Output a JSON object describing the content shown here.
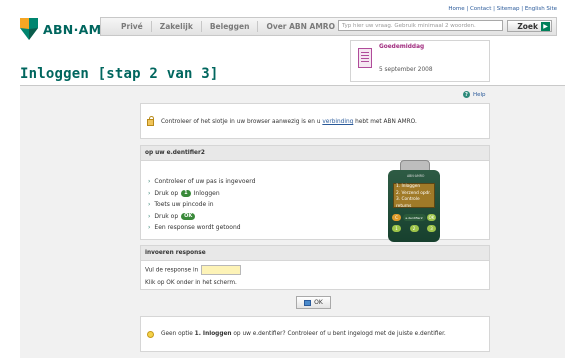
{
  "top_links": "Home | Contact | Sitemap | English Site",
  "brand": {
    "name": "ABN·AMRO"
  },
  "nav": {
    "items": [
      "Privé",
      "Zakelijk",
      "Beleggen",
      "Over ABN AMRO"
    ],
    "search_placeholder": "Typ hier uw vraag. Gebruik minimaal 2 woorden.",
    "search_button": "Zoek"
  },
  "greeting": {
    "title": "Goedemiddag",
    "date": "5 september 2008"
  },
  "page_title": "Inloggen [stap 2 van 3]",
  "help_label": "Help",
  "security_note": {
    "before": "Controleer of het slotje in uw browser aanwezig is en u ",
    "link": "verbinding",
    "after": " hebt met ABN AMRO."
  },
  "edentifier": {
    "heading": "op uw e.dentifier2",
    "steps": {
      "s1": "Controleer of uw pas is ingevoerd",
      "s2_pre": "Druk op",
      "s2_key": "1",
      "s2_post": "Inloggen",
      "s3": "Toets uw pincode in",
      "s4_pre": "Druk op",
      "s4_key": "OK",
      "s5": "Een response wordt getoond"
    },
    "device": {
      "brand": "ABN·AMRO",
      "screen_lines": [
        "1. Inloggen",
        "2. Verzend opdr.",
        "3. Controle returns"
      ],
      "key_left": "C",
      "key_mid": "e.dentifier2",
      "key_right": "OK",
      "keys_bottom": [
        "1",
        "2",
        "3"
      ]
    }
  },
  "response": {
    "heading": "invoeren response",
    "label": "Vul de response in",
    "value": "",
    "instruction": "Klik op OK onder in het scherm."
  },
  "ok_button": "OK",
  "tip": {
    "pre": "Geen optie ",
    "bold": "1. Inloggen",
    "post": " op uw e.dentifier? Controleer of u bent ingelogd met de juiste e.dentifier."
  }
}
